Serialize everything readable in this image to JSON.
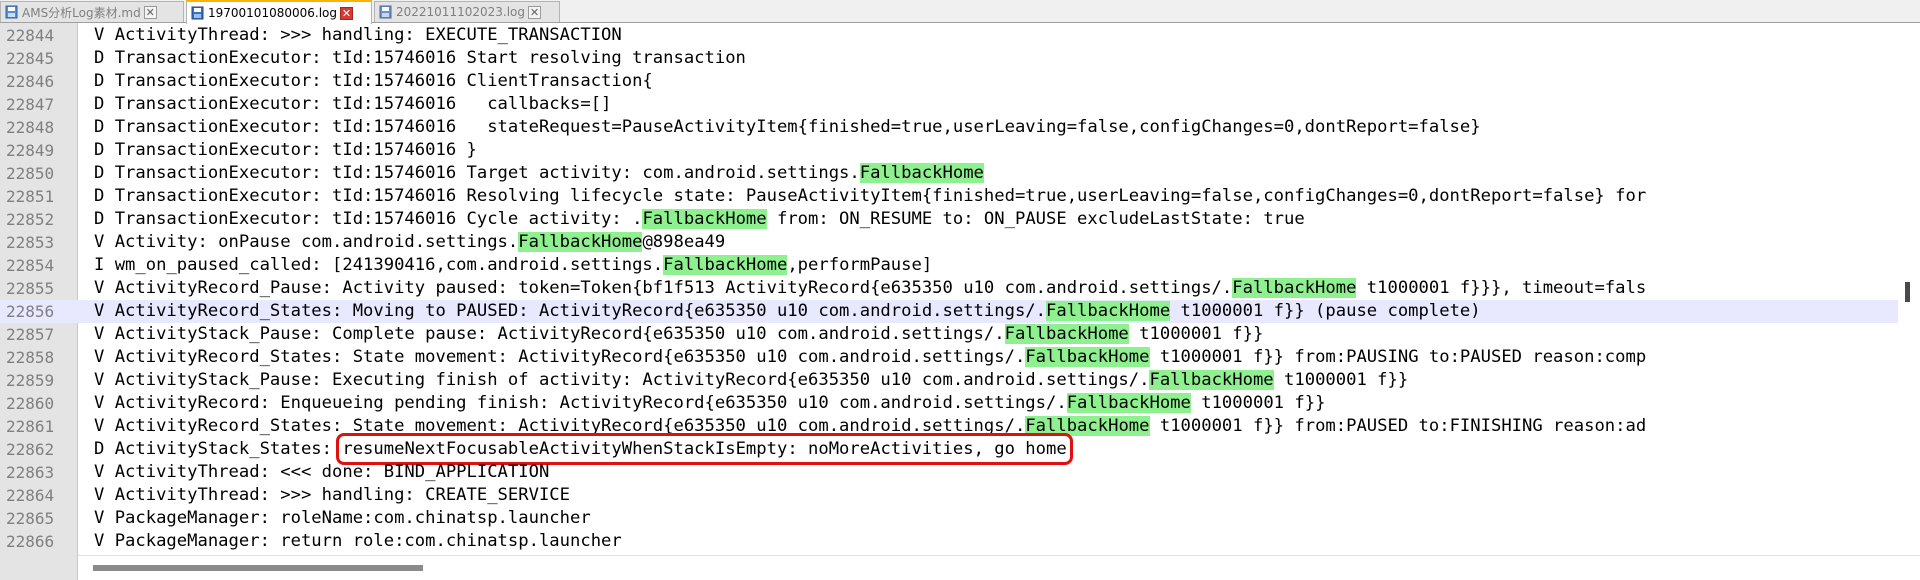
{
  "tabs": [
    {
      "label": "AMS分析Log素材.md",
      "icon": "markdown-file-icon",
      "active": false
    },
    {
      "label": "19700101080006.log",
      "icon": "floppy-disk-icon",
      "active": true
    },
    {
      "label": "20221011102023.log",
      "icon": "floppy-disk-icon",
      "active": false
    }
  ],
  "close_glyph": "✕",
  "editor": {
    "current_line": "22856",
    "highlight_term": "FallbackHome",
    "boxed_text": "resumeNextFocusableActivityWhenStackIsEmpty: noMoreActivities, go home",
    "lines": [
      {
        "num": "22844",
        "pre": "V ActivityThread: >>> handling: EXECUTE_TRANSACTION"
      },
      {
        "num": "22845",
        "pre": "D TransactionExecutor: tId:15746016 Start resolving transaction"
      },
      {
        "num": "22846",
        "pre": "D TransactionExecutor: tId:15746016 ClientTransaction{"
      },
      {
        "num": "22847",
        "pre": "D TransactionExecutor: tId:15746016   callbacks=[]"
      },
      {
        "num": "22848",
        "pre": "D TransactionExecutor: tId:15746016   stateRequest=PauseActivityItem{finished=true,userLeaving=false,configChanges=0,dontReport=false}"
      },
      {
        "num": "22849",
        "pre": "D TransactionExecutor: tId:15746016 }"
      },
      {
        "num": "22850",
        "pre": "D TransactionExecutor: tId:15746016 Target activity: com.android.settings.",
        "hl": "FallbackHome",
        "post": ""
      },
      {
        "num": "22851",
        "pre": "D TransactionExecutor: tId:15746016 Resolving lifecycle state: PauseActivityItem{finished=true,userLeaving=false,configChanges=0,dontReport=false} for"
      },
      {
        "num": "22852",
        "pre": "D TransactionExecutor: tId:15746016 Cycle activity: .",
        "hl": "FallbackHome",
        "post": " from: ON_RESUME to: ON_PAUSE excludeLastState: true"
      },
      {
        "num": "22853",
        "pre": "V Activity: onPause com.android.settings.",
        "hl": "FallbackHome",
        "post": "@898ea49"
      },
      {
        "num": "22854",
        "pre": "I wm_on_paused_called: [241390416,com.android.settings.",
        "hl": "FallbackHome",
        "post": ",performPause]"
      },
      {
        "num": "22855",
        "pre": "V ActivityRecord_Pause: Activity paused: token=Token{bf1f513 ActivityRecord{e635350 u10 com.android.settings/.",
        "hl": "FallbackHome",
        "post": " t1000001 f}}}, timeout=fals"
      },
      {
        "num": "22856",
        "pre": "V ActivityRecord_States: Moving to PAUSED: ActivityRecord{e635350 u10 com.android.settings/.",
        "hl": "FallbackHome",
        "post": " t1000001 f}} (pause complete)"
      },
      {
        "num": "22857",
        "pre": "V ActivityStack_Pause: Complete pause: ActivityRecord{e635350 u10 com.android.settings/.",
        "hl": "FallbackHome",
        "post": " t1000001 f}}"
      },
      {
        "num": "22858",
        "pre": "V ActivityRecord_States: State movement: ActivityRecord{e635350 u10 com.android.settings/.",
        "hl": "FallbackHome",
        "post": " t1000001 f}} from:PAUSING to:PAUSED reason:comp"
      },
      {
        "num": "22859",
        "pre": "V ActivityStack_Pause: Executing finish of activity: ActivityRecord{e635350 u10 com.android.settings/.",
        "hl": "FallbackHome",
        "post": " t1000001 f}}"
      },
      {
        "num": "22860",
        "pre": "V ActivityRecord: Enqueueing pending finish: ActivityRecord{e635350 u10 com.android.settings/.",
        "hl": "FallbackHome",
        "post": " t1000001 f}}"
      },
      {
        "num": "22861",
        "pre": "V ActivityRecord_States: State movement: ActivityRecord{e635350 u10 com.android.settings/.",
        "hl": "FallbackHome",
        "post": " t1000001 f}} from:PAUSED to:FINISHING reason:ad"
      },
      {
        "num": "22862",
        "pre": "D ActivityStack_States: ",
        "boxed": "resumeNextFocusableActivityWhenStackIsEmpty: noMoreActivities, go home",
        "post": ""
      },
      {
        "num": "22863",
        "pre": "V ActivityThread: <<< done: BIND_APPLICATION"
      },
      {
        "num": "22864",
        "pre": "V ActivityThread: >>> handling: CREATE_SERVICE"
      },
      {
        "num": "22865",
        "pre": "V PackageManager: roleName:com.chinatsp.launcher"
      },
      {
        "num": "22866",
        "pre": "V PackageManager: return role:com.chinatsp.launcher"
      }
    ]
  },
  "colors": {
    "highlight": "#8ef08e",
    "box": "#e01010",
    "current_line": "#e8e8ff",
    "gutter": "#e4e4e4",
    "line_number": "#808080"
  }
}
